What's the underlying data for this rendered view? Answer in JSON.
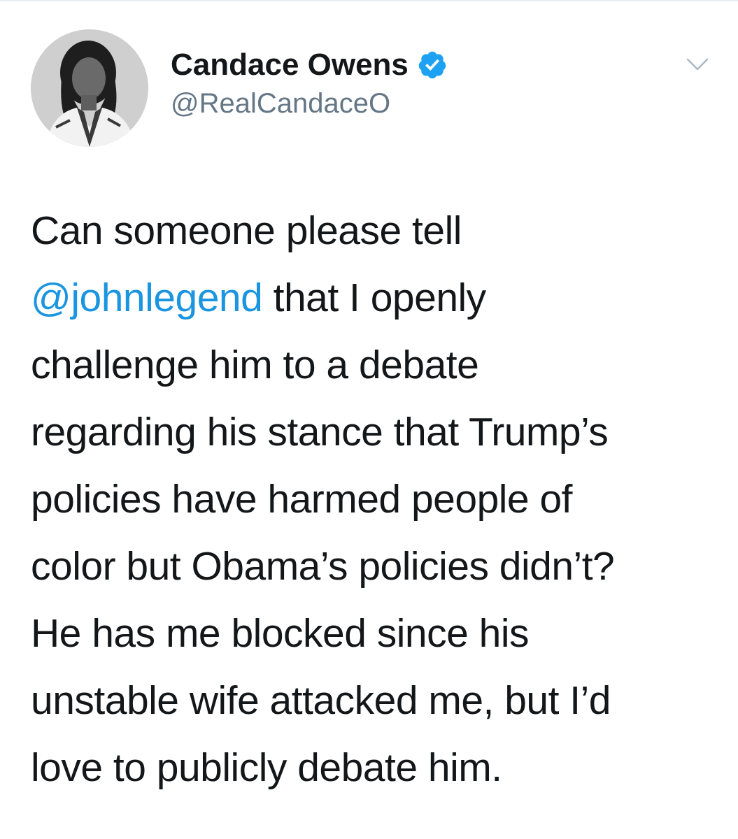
{
  "author": {
    "display_name": "Candace Owens",
    "handle": "@RealCandaceO",
    "verified": true,
    "avatar": "profile-photo-grayscale"
  },
  "icons": {
    "verified": "verified-badge-icon",
    "menu": "chevron-down-icon"
  },
  "colors": {
    "mention": "#1b95e0",
    "verified_badge": "#1da1f2",
    "handle": "#657786",
    "text": "#14171a"
  },
  "tweet": {
    "lines": [
      {
        "text": "Can someone please tell"
      },
      {
        "mention": "@johnlegend",
        "after": " that I openly"
      },
      {
        "text": "challenge him to a debate"
      },
      {
        "text": "regarding his stance that Trump’s"
      },
      {
        "text": "policies have harmed people of"
      },
      {
        "text": "color but Obama’s policies didn’t?"
      },
      {
        "text": "He has me blocked since his"
      },
      {
        "text": "unstable wife attacked me, but I’d"
      },
      {
        "text": "love to publicly debate him."
      }
    ]
  }
}
